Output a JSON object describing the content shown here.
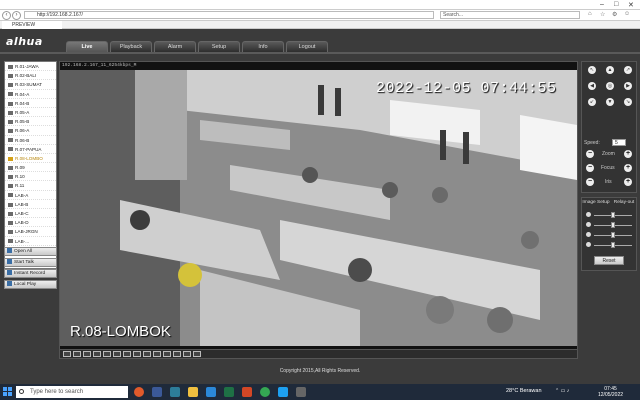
{
  "browser": {
    "url": "http://192.168.2.167/",
    "search_placeholder": "Search...",
    "tab_title": "PREVIEW"
  },
  "app": {
    "logo": "alhua",
    "nav": [
      {
        "label": "Live"
      },
      {
        "label": "Playback"
      },
      {
        "label": "Alarm"
      },
      {
        "label": "Setup"
      },
      {
        "label": "Info"
      },
      {
        "label": "Logout"
      }
    ],
    "active_nav": "Live",
    "cameras": [
      "R.01-JAWA",
      "R.02-BALI",
      "R.03-SUMAT",
      "R.04-A",
      "R.04-B",
      "R.05-A",
      "R.05-B",
      "R.06-A",
      "R.06-B",
      "R.07-PAPUA",
      "R.08-LOMBO",
      "R.09",
      "R.10",
      "R.11",
      "LAB-A",
      "LAB-B",
      "LAB-C",
      "LAB-D",
      "LAB-JRGN",
      "LAB-..."
    ],
    "selected_camera": "R.08-LOMBO",
    "sidebar_actions": [
      {
        "label": "Open All"
      },
      {
        "label": "Start Talk"
      },
      {
        "label": "Instant Record"
      },
      {
        "label": "Local Play"
      }
    ],
    "stream_info": "192.168.2.167_11_6254kbps_M",
    "osd_timestamp": "2022-12-05 07:44:55",
    "osd_channel_name": "R.08-LOMBOK",
    "ptz": {
      "speed_label": "Speed:",
      "speed_value": "5",
      "zoom_label": "Zoom",
      "focus_label": "Focus",
      "iris_label": "Iris"
    },
    "image_setup": {
      "tab_image": "Image Setup",
      "tab_relay": "Relay-out",
      "brightness": 0.5,
      "contrast": 0.5,
      "hue": 0.5,
      "saturation": 0.5,
      "reset_label": "Reset"
    },
    "copyright": "Copyright 2015,All Rights Reserved."
  },
  "taskbar": {
    "search_placeholder": "Type here to search",
    "weather": "28°C  Berawan",
    "time": "07:45",
    "date": "12/05/2022"
  }
}
